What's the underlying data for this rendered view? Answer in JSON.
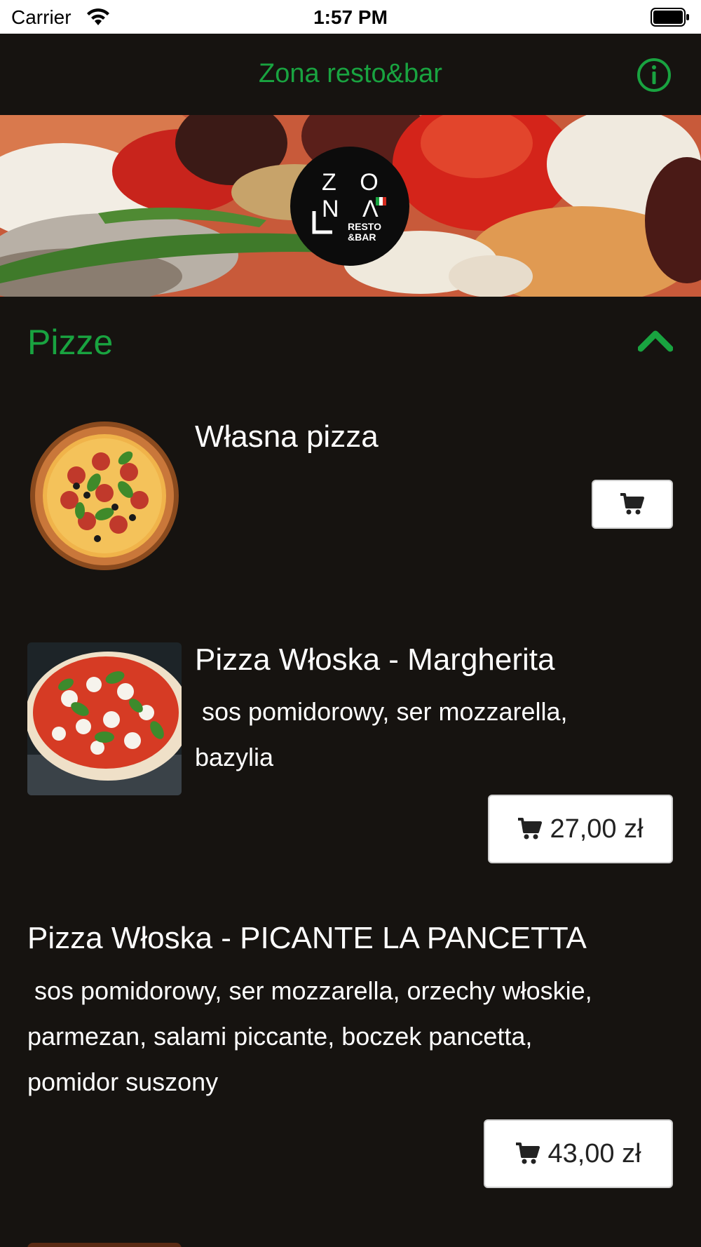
{
  "status_bar": {
    "carrier": "Carrier",
    "time": "1:57 PM"
  },
  "nav": {
    "title": "Zona resto&bar",
    "info_icon": "info-circle-icon"
  },
  "hero": {
    "logo": {
      "line1": "Z O",
      "line2": "N Λ",
      "sub1": "RESTO",
      "sub2": "&BAR"
    }
  },
  "section": {
    "title": "Pizze",
    "expanded": true
  },
  "items": [
    {
      "name": "Własna pizza",
      "description_lines": [],
      "price": ""
    },
    {
      "name": "Pizza Włoska - Margherita",
      "description_lines": [
        " sos pomidorowy, ser mozzarella,",
        "bazylia"
      ],
      "price": "27,00 zł"
    },
    {
      "name": "Pizza Włoska - PICANTE LA PANCETTA",
      "description_lines": [
        " sos pomidorowy, ser mozzarella, orzechy włoskie,",
        "parmezan, salami piccante, boczek pancetta,",
        "pomidor suszony"
      ],
      "price": "43,00 zł"
    }
  ],
  "colors": {
    "accent": "#19a340",
    "background": "#161310",
    "button_bg": "#ffffff"
  }
}
